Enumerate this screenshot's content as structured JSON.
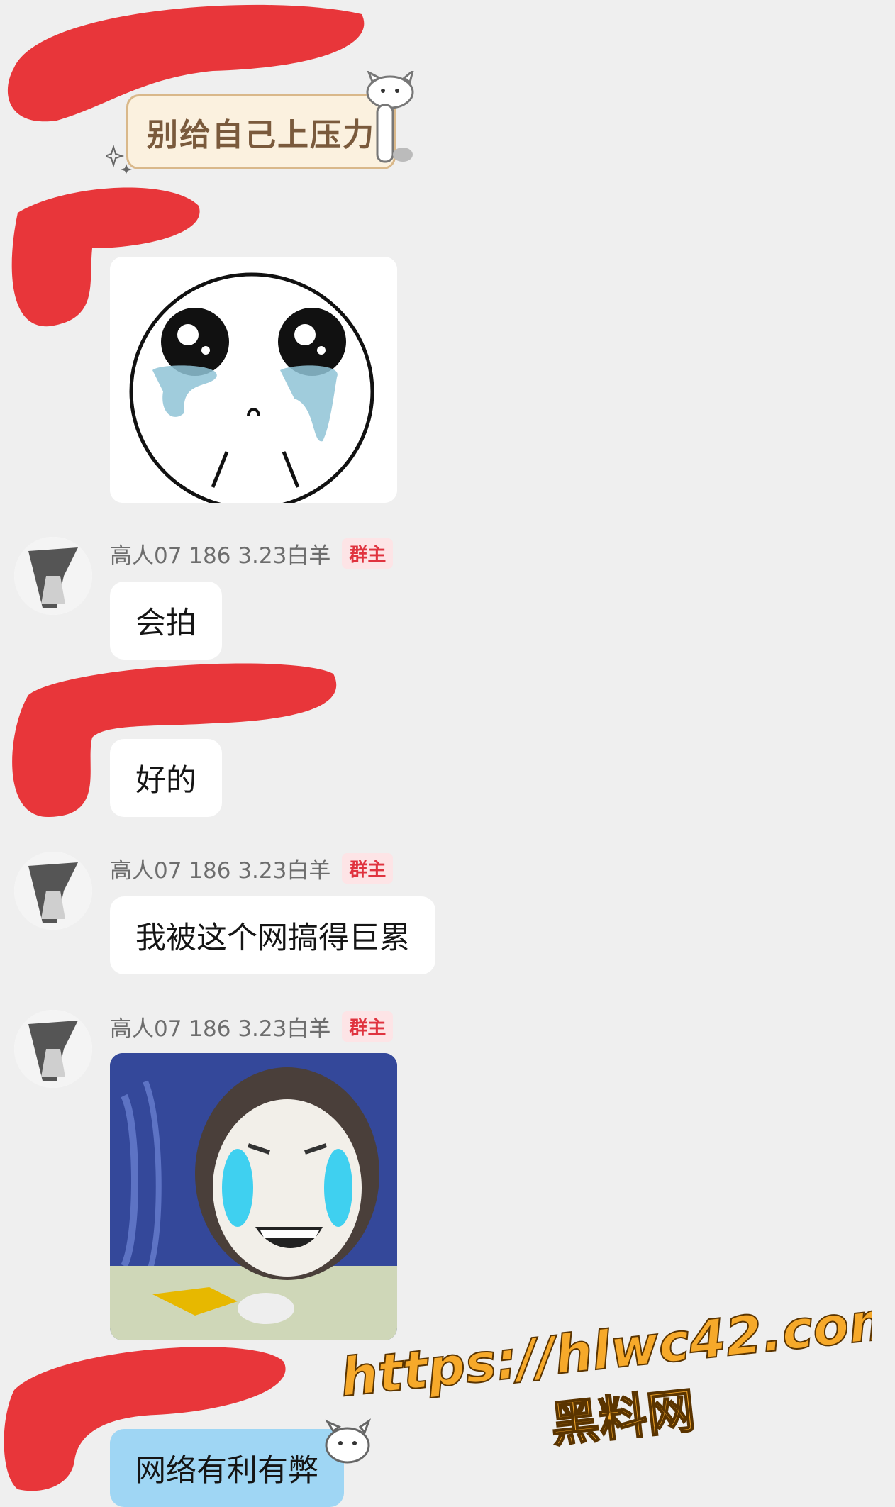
{
  "sticker_text": "别给自己上压力",
  "messages": [
    {
      "sender": "高人07 186 3.23白羊",
      "badge": "群主",
      "text": "会拍"
    },
    {
      "text": "好的"
    },
    {
      "sender": "高人07 186 3.23白羊",
      "badge": "群主",
      "text": "我被这个网搞得巨累"
    },
    {
      "sender": "高人07 186 3.23白羊",
      "badge": "群主"
    },
    {
      "text": "网络有利有弊"
    }
  ],
  "watermark": {
    "url": "https://hlwc42.com",
    "site_name": "黑料网"
  },
  "colors": {
    "background": "#efefef",
    "bubble": "#ffffff",
    "bubble_blue": "#9fd6f4",
    "badge_text": "#e0333f",
    "badge_bg": "#fde4e6",
    "redaction": "#e8363a",
    "watermark": "#f6a92a"
  }
}
